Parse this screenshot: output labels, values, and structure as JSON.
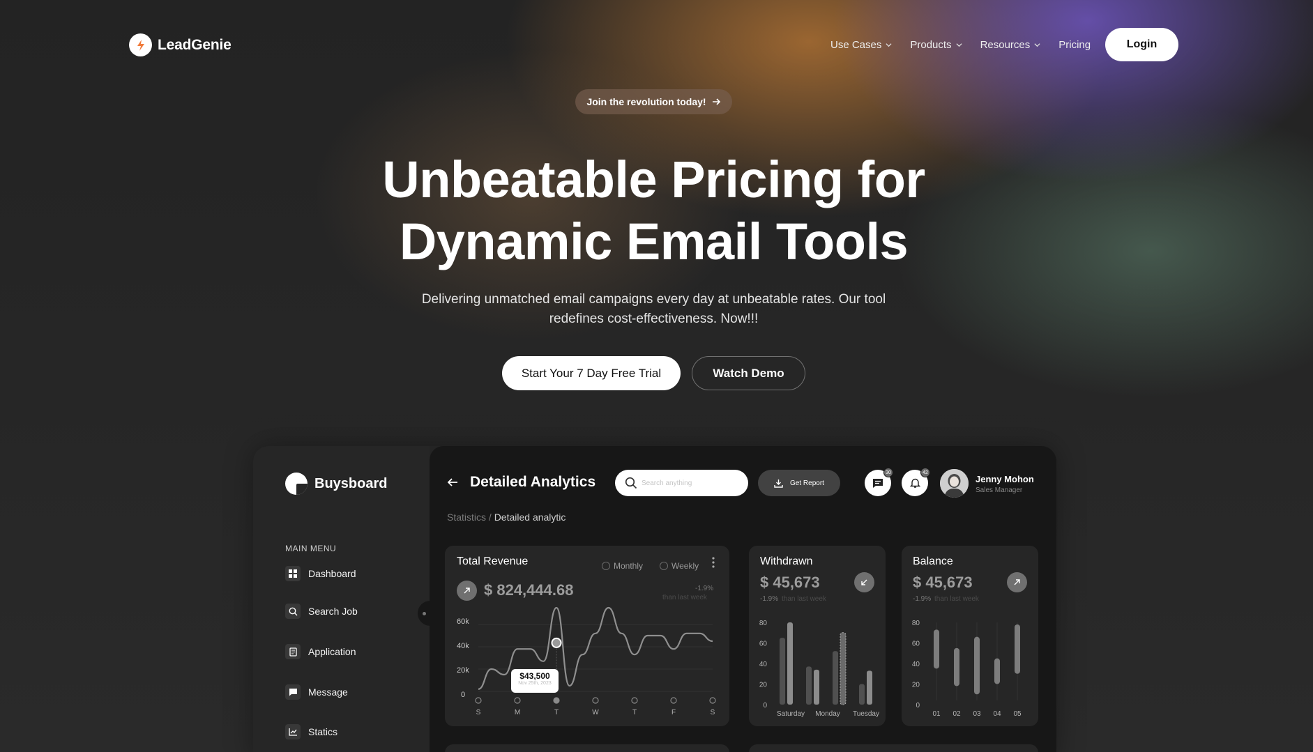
{
  "brand": {
    "name": "LeadGenie"
  },
  "nav": {
    "items": [
      {
        "label": "Use Cases",
        "dropdown": true
      },
      {
        "label": "Products",
        "dropdown": true
      },
      {
        "label": "Resources",
        "dropdown": true
      },
      {
        "label": "Pricing",
        "dropdown": false
      }
    ],
    "login_label": "Login"
  },
  "hero": {
    "pill": "Join the revolution today!",
    "title_line1": "Unbeatable Pricing for",
    "title_line2": "Dynamic Email Tools",
    "subtitle_line1": "Delivering unmatched email campaigns every day at unbeatable rates. Our tool",
    "subtitle_line2": "redefines cost-effectiveness. Now!!!",
    "cta_primary": "Start Your 7 Day Free Trial",
    "cta_secondary": "Watch Demo"
  },
  "dashboard": {
    "app_name": "Buysboard",
    "menu_title": "MAIN MENU",
    "menu": [
      {
        "label": "Dashboard",
        "icon": "grid-icon"
      },
      {
        "label": "Search Job",
        "icon": "search-icon"
      },
      {
        "label": "Application",
        "icon": "document-icon"
      },
      {
        "label": "Message",
        "icon": "message-icon"
      },
      {
        "label": "Statics",
        "icon": "chart-icon"
      }
    ],
    "page_title": "Detailed Analytics",
    "search_placeholder": "Search anything",
    "report_label": "Get Report",
    "messages_badge": "30",
    "notifications_badge": "42",
    "user": {
      "name": "Jenny Mohon",
      "role": "Sales Manager"
    },
    "breadcrumb": {
      "parent": "Statistics",
      "separator": " / ",
      "current": "Detailed analytic"
    },
    "revenue": {
      "title": "Total Revenue",
      "toggle_monthly": "Monthly",
      "toggle_weekly": "Weekly",
      "amount": "$ 824,444.68",
      "change": "-1.9%",
      "change_note": "than last week",
      "tooltip_value": "$43,500",
      "tooltip_date": "Nov 25th, 2023"
    },
    "withdrawn": {
      "title": "Withdrawn",
      "amount": "$ 45,673",
      "change": "-1.9%",
      "change_note": "than last week"
    },
    "balance": {
      "title": "Balance",
      "amount": "$ 45,673",
      "change": "-1.9%",
      "change_note": "than last week"
    }
  },
  "chart_data": [
    {
      "type": "line",
      "title": "Total Revenue",
      "x": [
        "S",
        "M",
        "T",
        "W",
        "T",
        "F",
        "S"
      ],
      "y_ticks": [
        "0",
        "20k",
        "40k",
        "60k"
      ],
      "ylim": [
        0,
        70000
      ],
      "series": [
        {
          "values": [
            2000,
            20000,
            15000,
            38000,
            38000,
            27000,
            75000,
            5000,
            33000,
            52000,
            75000,
            52000,
            33000,
            50000,
            50000,
            38000,
            52000,
            52000,
            45000
          ]
        }
      ],
      "highlight": {
        "x": "T",
        "value": 43500,
        "label": "$43,500",
        "date": "Nov 25th, 2023"
      }
    },
    {
      "type": "bar",
      "title": "Withdrawn",
      "categories": [
        "Saturday",
        "Monday",
        "Tuesday"
      ],
      "y_ticks": [
        "0",
        "20",
        "40",
        "60",
        "80"
      ],
      "ylim": [
        0,
        80
      ],
      "series": [
        {
          "values": [
            65,
            37,
            52,
            20
          ]
        },
        {
          "values": [
            80,
            34,
            70,
            33
          ]
        }
      ]
    },
    {
      "type": "bar",
      "title": "Balance",
      "categories": [
        "01",
        "02",
        "03",
        "04",
        "05"
      ],
      "y_ticks": [
        "0",
        "20",
        "40",
        "60",
        "80"
      ],
      "ylim": [
        0,
        80
      ],
      "ranges": [
        [
          35,
          73
        ],
        [
          18,
          55
        ],
        [
          10,
          66
        ],
        [
          20,
          45
        ],
        [
          30,
          78
        ]
      ]
    }
  ],
  "colors": {
    "accent": "#f07a3a",
    "card_bg": "#262626",
    "main_bg": "#171717"
  }
}
